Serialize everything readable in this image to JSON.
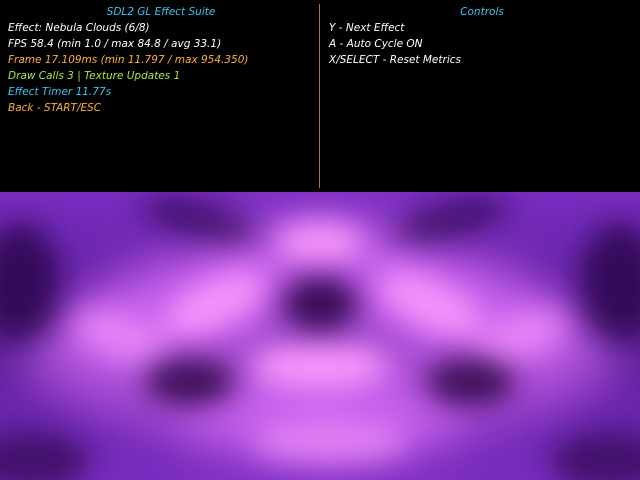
{
  "colors": {
    "title": "#36c6f0",
    "white": "#ffffff",
    "orange": "#ffb02e",
    "green": "#a8e640",
    "cyan": "#36c6f0",
    "divider": "#b8703a",
    "nebula_deep": "#1e0638",
    "nebula_mid": "#7a2cc0",
    "nebula_bright": "#e070ff",
    "nebula_core": "#ff9cff"
  },
  "left_panel": {
    "title": "SDL2 GL Effect Suite",
    "effect": "Effect: Nebula Clouds (6/8)",
    "fps": "FPS 58.4 (min 1.0 / max 84.8 / avg 33.1)",
    "frame": "Frame 17.109ms (min 11.797 / max 954.350)",
    "draw_calls": "Draw Calls 3 | Texture Updates 1",
    "effect_timer": "Effect Timer 11.77s",
    "back": "Back - START/ESC"
  },
  "right_panel": {
    "title": "Controls",
    "next_effect": "Y - Next Effect",
    "auto_cycle": "A - Auto Cycle ON",
    "reset_metrics": "X/SELECT - Reset Metrics"
  }
}
